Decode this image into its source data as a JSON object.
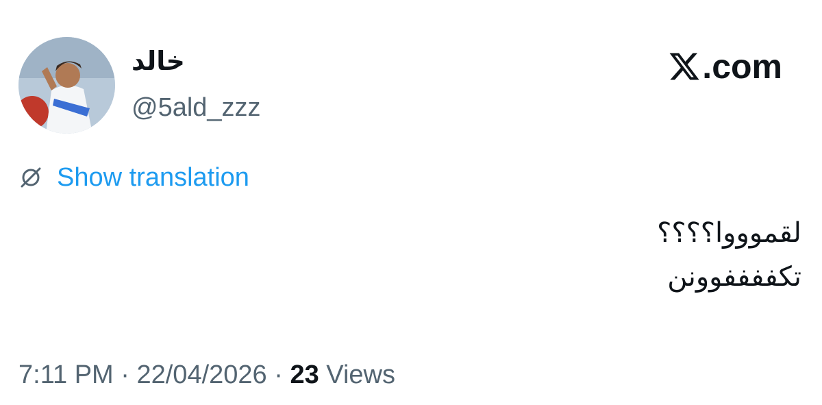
{
  "author": {
    "display_name": "خالد",
    "handle": "@5ald_zzz",
    "avatar_icon": "avatar"
  },
  "brand": {
    "domain_label": ".com",
    "logo_icon": "x-logo-icon"
  },
  "translation": {
    "label": "Show translation",
    "icon": "globe-slash-icon",
    "color": "#1d9bf0"
  },
  "tweet": {
    "lines": [
      "لقموووا؟؟؟؟",
      "تكففففوونن"
    ]
  },
  "meta": {
    "time": "7:11 PM",
    "separator": "·",
    "date": "22/04/2026",
    "views_count": "23",
    "views_label": "Views"
  },
  "colors": {
    "text": "#0f1419",
    "secondary": "#536471",
    "accent": "#1d9bf0"
  }
}
